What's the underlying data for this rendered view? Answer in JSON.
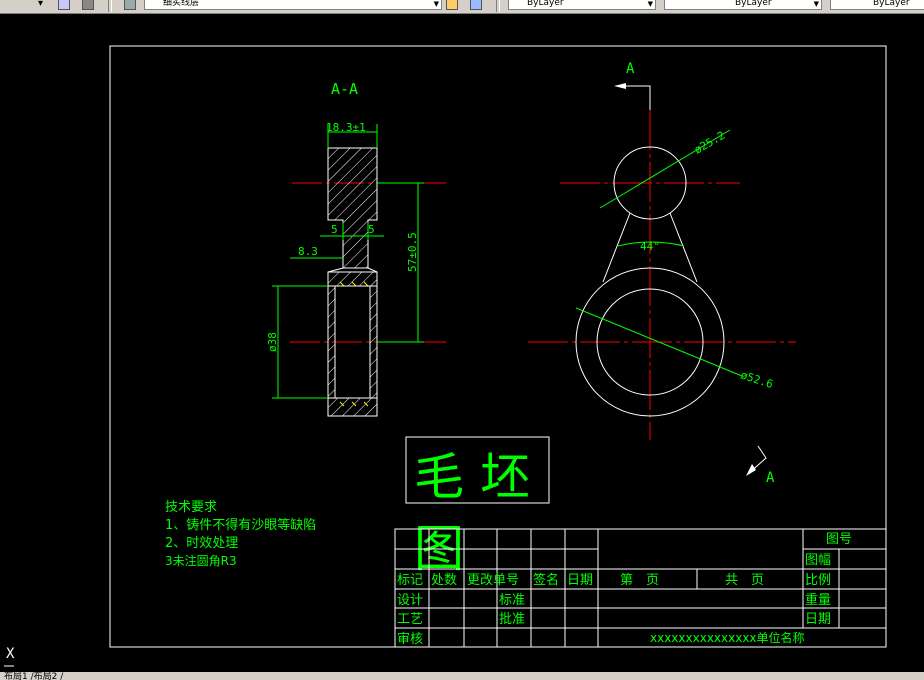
{
  "toolbar": {
    "layer_combo_text": "细实线层",
    "color_combo_text": "ByLayer",
    "linetype_combo_text": "ByLayer",
    "lineweight_combo_text": "ByLayer"
  },
  "drawing": {
    "section_label": "A-A",
    "view_label_top": "A",
    "view_label_arrow": "A",
    "dims": {
      "width_top": "18.3±1",
      "slot_left": "5",
      "slot_right": "5",
      "depth": "8.3",
      "center_dist": "57±0.5",
      "bore_dia": "ø38",
      "small_dia": "ø25.2",
      "angle": "44°",
      "large_dia": "ø52.6"
    },
    "title_big": "毛坯图",
    "tech_req": {
      "heading": "技术要求",
      "items": [
        "1、铸件不得有沙眼等缺陷",
        "2、时效处理",
        "3未注圆角R3"
      ]
    },
    "title_block": {
      "drawing_no": "图号",
      "format": "图幅",
      "scale": "比例",
      "weight": "重量",
      "date": "日期",
      "mark": "标记",
      "count": "处数",
      "change_doc": "更改单号",
      "sign": "签名",
      "date2": "日期",
      "page_no": "第　页",
      "total_pages": "共　页",
      "design": "设计",
      "process": "工艺",
      "review": "审核",
      "standard": "标准",
      "approve": "批准",
      "unit_name": "xxxxxxxxxxxxxxx单位名称"
    }
  },
  "statusbar": {
    "tabs": "布局1 /布局2 /"
  },
  "ucs_label": "X",
  "colors": {
    "background": "#000000",
    "green": "#00ff00",
    "red": "#ff0000",
    "white": "#ffffff",
    "hatch_yellow": "#ffff00"
  }
}
